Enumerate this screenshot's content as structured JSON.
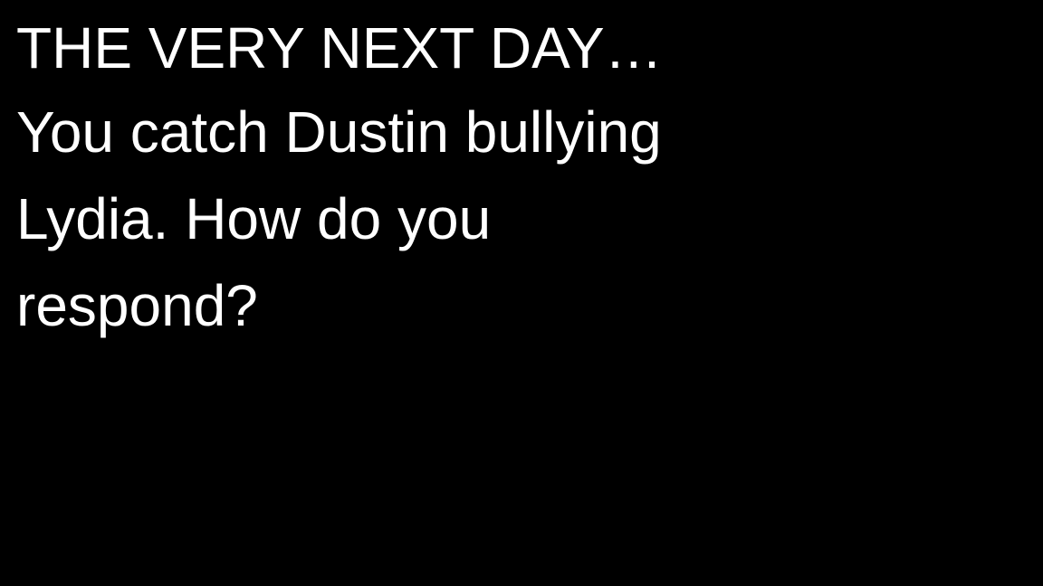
{
  "slide": {
    "background_color": "#000000",
    "text_color": "#ffffff",
    "heading": "THE VERY NEXT DAY…",
    "body_lines": [
      "You catch Dustin bullying",
      "Lydia. How do you",
      "respond?"
    ]
  }
}
